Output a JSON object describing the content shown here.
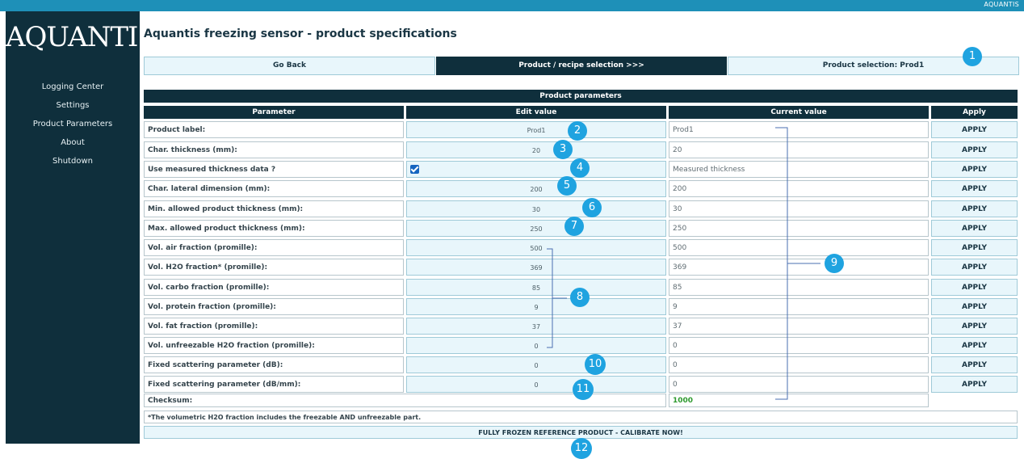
{
  "topbar": {
    "brand": "AQUANTIS"
  },
  "sidebar": {
    "logo": "AQUANTIS",
    "items": [
      {
        "label": "Logging Center"
      },
      {
        "label": "Settings"
      },
      {
        "label": "Product Parameters"
      },
      {
        "label": "About"
      },
      {
        "label": "Shutdown"
      }
    ]
  },
  "page": {
    "title": "Aquantis freezing sensor - product specifications"
  },
  "buttons": {
    "go_back": "Go Back",
    "product_recipe": "Product / recipe selection >>>",
    "product_selection": "Product selection: Prod1"
  },
  "table": {
    "header": "Product parameters",
    "columns": [
      "Parameter",
      "Edit value",
      "Current value",
      "Apply"
    ],
    "apply_label": "APPLY",
    "rows": [
      {
        "label": "Product label:",
        "edit": "Prod1",
        "current": "Prod1"
      },
      {
        "label": "Char. thickness (mm):",
        "edit": "20",
        "current": "20"
      },
      {
        "label": "Use measured thickness data ?",
        "edit": "",
        "current": "Measured thickness",
        "checkbox": true
      },
      {
        "label": "Char. lateral dimension (mm):",
        "edit": "200",
        "current": "200"
      },
      {
        "label": "Min. allowed product thickness (mm):",
        "edit": "30",
        "current": "30"
      },
      {
        "label": "Max. allowed product thickness (mm):",
        "edit": "250",
        "current": "250"
      },
      {
        "label": "Vol. air fraction (promille):",
        "edit": "500",
        "current": "500"
      },
      {
        "label": "Vol. H2O fraction* (promille):",
        "edit": "369",
        "current": "369"
      },
      {
        "label": "Vol. carbo fraction (promille):",
        "edit": "85",
        "current": "85"
      },
      {
        "label": "Vol. protein fraction (promille):",
        "edit": "9",
        "current": "9"
      },
      {
        "label": "Vol. fat fraction (promille):",
        "edit": "37",
        "current": "37"
      },
      {
        "label": "Vol. unfreezable H2O fraction (promille):",
        "edit": "0",
        "current": "0"
      },
      {
        "label": "Fixed scattering parameter (dB):",
        "edit": "0",
        "current": "0"
      },
      {
        "label": "Fixed scattering parameter (dB/mm):",
        "edit": "0",
        "current": "0"
      }
    ],
    "checksum": {
      "label": "Checksum:",
      "value": "1000",
      "value_color": "#2e9a2e"
    }
  },
  "footnote": "*The volumetric H2O fraction includes the freezable AND unfreezable part.",
  "calibrate_button": "FULLY FROZEN REFERENCE PRODUCT - CALIBRATE NOW!",
  "markers": [
    "1",
    "2",
    "3",
    "4",
    "5",
    "6",
    "7",
    "8",
    "9",
    "10",
    "11",
    "12"
  ],
  "colors": {
    "sidebar": "#0f2f3c",
    "topbar": "#1e90b8",
    "marker": "#1fa3e0",
    "cell_bg": "#e8f6fb"
  }
}
